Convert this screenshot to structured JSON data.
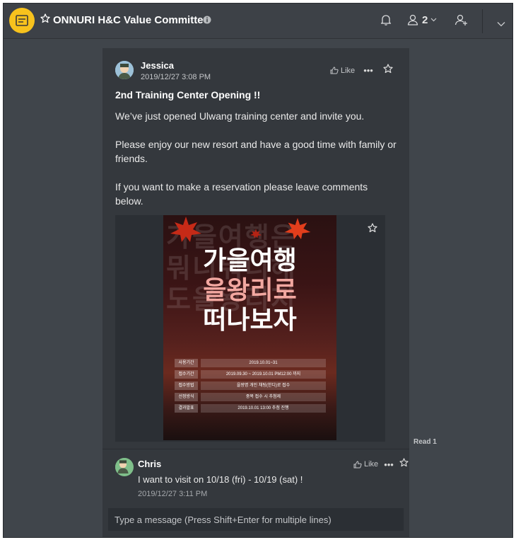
{
  "header": {
    "title": "ONNURI H&C Value Committee",
    "member_count": "2",
    "accent": "#f7c21d"
  },
  "post": {
    "author": "Jessica",
    "time": "2019/12/27 3:08 PM",
    "like_label": "Like",
    "more_label": "•••",
    "title": "2nd Training Center Opening !!",
    "body": [
      "We’ve just opened Ulwang training center and invite you.",
      "Please enjoy our new resort and have a good time with family or friends.",
      "If you want to make a reservation please leave comments below."
    ],
    "image": {
      "line1": "가을여행",
      "line2": "을왕리로",
      "line3": "떠나보자",
      "rows": [
        {
          "key": "사용기간",
          "value": "2019.10.01~31"
        },
        {
          "key": "접수기간",
          "value": "2019.09.30 ~ 2019.10.01 PM12:00 까지"
        },
        {
          "key": "접수방법",
          "value": "을왕명 개인 채팅(한디)로 접수"
        },
        {
          "key": "선정방식",
          "value": "중복 접수 시 추첨제"
        },
        {
          "key": "결과발표",
          "value": "2019.10.01 13:00 추첨 진행"
        }
      ]
    }
  },
  "read_receipt": "Read 1",
  "comment": {
    "author": "Chris",
    "text": "I want to visit on 10/18 (fri) - 10/19 (sat) !",
    "time": "2019/12/27 3:11 PM",
    "like_label": "Like",
    "more_label": "•••"
  },
  "composer": {
    "placeholder": "Type a message (Press Shift+Enter for multiple lines)"
  }
}
